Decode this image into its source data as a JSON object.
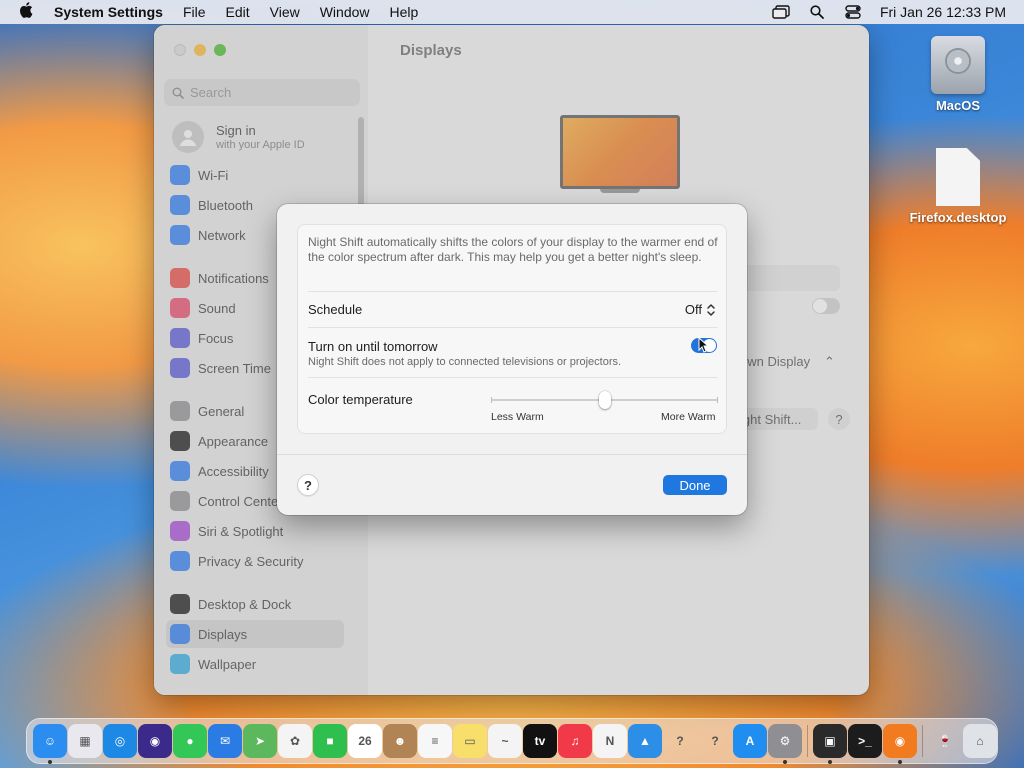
{
  "menubar": {
    "app_name": "System Settings",
    "menus": [
      "File",
      "Edit",
      "View",
      "Window",
      "Help"
    ],
    "clock": "Fri Jan 26  12:33 PM"
  },
  "desktop": {
    "icons": [
      {
        "label": "MacOS",
        "icon": "hard-disk-icon"
      },
      {
        "label": "Firefox.desktop",
        "icon": "file-icon"
      }
    ]
  },
  "window": {
    "title": "Displays",
    "search_placeholder": "Search",
    "signin": {
      "title": "Sign in",
      "subtitle": "with your Apple ID"
    },
    "sidebar_items": [
      {
        "label": "Wi-Fi",
        "icon": "wifi-icon",
        "color": "#2f7bf0"
      },
      {
        "label": "Bluetooth",
        "icon": "bluetooth-icon",
        "color": "#2f7bf0"
      },
      {
        "label": "Network",
        "icon": "globe-icon",
        "color": "#2f7bf0"
      },
      {
        "label": "Notifications",
        "icon": "bell-icon",
        "color": "#e64b47"
      },
      {
        "label": "Sound",
        "icon": "speaker-icon",
        "color": "#e64b6a"
      },
      {
        "label": "Focus",
        "icon": "moon-icon",
        "color": "#5b5bd6"
      },
      {
        "label": "Screen Time",
        "icon": "hourglass-icon",
        "color": "#5b5bd6"
      },
      {
        "label": "General",
        "icon": "gear-icon",
        "color": "#8e8e93"
      },
      {
        "label": "Appearance",
        "icon": "appearance-icon",
        "color": "#1c1c1e"
      },
      {
        "label": "Accessibility",
        "icon": "accessibility-icon",
        "color": "#2f7bf0"
      },
      {
        "label": "Control Center",
        "icon": "control-center-icon",
        "color": "#8e8e93"
      },
      {
        "label": "Siri & Spotlight",
        "icon": "siri-icon",
        "color": "#a64bd6"
      },
      {
        "label": "Privacy & Security",
        "icon": "hand-icon",
        "color": "#2f7bf0"
      },
      {
        "label": "Desktop & Dock",
        "icon": "dock-icon",
        "color": "#1c1c1e"
      },
      {
        "label": "Displays",
        "icon": "sun-icon",
        "color": "#2f7bf0"
      },
      {
        "label": "Wallpaper",
        "icon": "wallpaper-icon",
        "color": "#35a8e0"
      }
    ],
    "background": {
      "popup_fragment": "own Display",
      "button_fragment": "ight Shift...",
      "help": "?"
    }
  },
  "night_shift": {
    "description": "Night Shift automatically shifts the colors of your display to the warmer end of the color spectrum after dark. This may help you get a better night's sleep.",
    "schedule_label": "Schedule",
    "schedule_value": "Off",
    "turn_on_label": "Turn on until tomorrow",
    "turn_on_note": "Night Shift does not apply to connected televisions or projectors.",
    "turn_on_state": true,
    "color_temp_label": "Color temperature",
    "color_temp_min_label": "Less Warm",
    "color_temp_max_label": "More Warm",
    "color_temp_value": 0.5,
    "help": "?",
    "done": "Done"
  },
  "dock": {
    "apps": [
      {
        "name": "finder-icon",
        "color": "#2c8df0",
        "glyph": "☺",
        "running": true
      },
      {
        "name": "launchpad-icon",
        "color": "#e8e8ee",
        "glyph": "▦",
        "running": false
      },
      {
        "name": "safari-icon",
        "color": "#1e88e5",
        "glyph": "◎",
        "running": false
      },
      {
        "name": "firefox-icon",
        "color": "#3b2a8a",
        "glyph": "◉",
        "running": false
      },
      {
        "name": "messages-icon",
        "color": "#32c756",
        "glyph": "●",
        "running": false
      },
      {
        "name": "mail-icon",
        "color": "#2b7be4",
        "glyph": "✉",
        "running": false
      },
      {
        "name": "maps-icon",
        "color": "#5cb85c",
        "glyph": "➤",
        "running": false
      },
      {
        "name": "photos-icon",
        "color": "#f4f4f4",
        "glyph": "✿",
        "running": false
      },
      {
        "name": "facetime-icon",
        "color": "#2fbf4f",
        "glyph": "■",
        "running": false
      },
      {
        "name": "calendar-icon",
        "color": "#ffffff",
        "glyph": "26",
        "running": false
      },
      {
        "name": "contacts-icon",
        "color": "#b08454",
        "glyph": "☻",
        "running": false
      },
      {
        "name": "reminders-icon",
        "color": "#f7f7f7",
        "glyph": "≡",
        "running": false
      },
      {
        "name": "notes-icon",
        "color": "#f8df6b",
        "glyph": "▭",
        "running": false
      },
      {
        "name": "freeform-icon",
        "color": "#f4f4f4",
        "glyph": "~",
        "running": false
      },
      {
        "name": "apple-tv-icon",
        "color": "#111111",
        "glyph": "tv",
        "running": false
      },
      {
        "name": "music-icon",
        "color": "#f2394a",
        "glyph": "♫",
        "running": false
      },
      {
        "name": "news-icon",
        "color": "#f4f4f4",
        "glyph": "N",
        "running": false
      },
      {
        "name": "keynote-icon",
        "color": "#2d8ee8",
        "glyph": "▲",
        "running": false
      },
      {
        "name": "question-icon",
        "color": "rgba(0,0,0,0)",
        "glyph": "?",
        "running": false
      },
      {
        "name": "question-icon",
        "color": "rgba(0,0,0,0)",
        "glyph": "?",
        "running": false
      },
      {
        "name": "app-store-icon",
        "color": "#1f8ef0",
        "glyph": "A",
        "running": false
      },
      {
        "name": "system-settings-icon",
        "color": "#8e8e93",
        "glyph": "⚙",
        "running": true
      },
      {
        "name": "sep",
        "color": "",
        "glyph": "",
        "running": false
      },
      {
        "name": "screenshot-icon",
        "color": "#2a2a2a",
        "glyph": "▣",
        "running": true
      },
      {
        "name": "terminal-icon",
        "color": "#1c1c1c",
        "glyph": ">_",
        "running": false
      },
      {
        "name": "firefox-icon",
        "color": "#f27a1f",
        "glyph": "◉",
        "running": true
      },
      {
        "name": "sep",
        "color": "",
        "glyph": "",
        "running": false
      },
      {
        "name": "wine-icon",
        "color": "rgba(0,0,0,0)",
        "glyph": "🍷",
        "running": false
      },
      {
        "name": "trash-icon",
        "color": "#dfe3e7",
        "glyph": "⌂",
        "running": false
      }
    ]
  }
}
